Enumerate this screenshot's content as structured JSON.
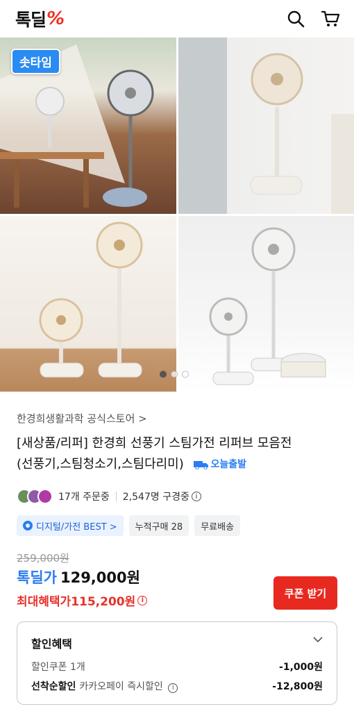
{
  "header": {
    "logo_text": "톡딜",
    "logo_mark": "%",
    "icons": [
      "search-icon",
      "cart-icon"
    ]
  },
  "gallery": {
    "badge": "솟타임",
    "pages": 3,
    "active_page": 1
  },
  "product": {
    "store": "한경희생활과학 공식스토어 >",
    "title_line1": "[새상품/리퍼] 한경희 선풍기 스팀가전 리퍼브 모음전",
    "title_line2": "(선풍기,스팀청소기,스팀다리미)",
    "ship_label": "오늘출발",
    "orders": "17개 주문중",
    "viewers": "2,547명 구경중",
    "tags": [
      "디지털/가전 BEST >",
      "누적구매 28",
      "무료배송"
    ],
    "original_price": "259,000원",
    "price_label": "톡딜가",
    "price": "129,000원",
    "max_benefit": "최대혜택가115,200원",
    "coupon_button": "쿠폰 받기"
  },
  "discount": {
    "title": "할인혜택",
    "rows": [
      {
        "label_bold": "",
        "label": "할인쿠폰 1개",
        "amount": "-1,000원"
      },
      {
        "label_bold": "선착순할인",
        "label": "카카오페이 즉시할인",
        "amount": "-12,800원"
      }
    ]
  },
  "colors": {
    "accent_red": "#e8291f",
    "accent_blue": "#2a7cf2"
  }
}
